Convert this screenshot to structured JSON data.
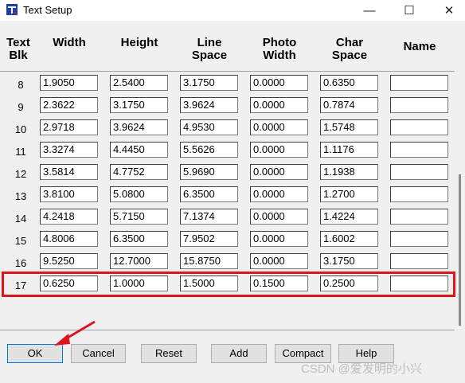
{
  "window": {
    "title": "Text Setup",
    "minimize_glyph": "—",
    "maximize_glyph": "☐",
    "close_glyph": "✕"
  },
  "headers": {
    "text_blk": [
      "Text",
      "Blk"
    ],
    "width": "Width",
    "height": "Height",
    "line_space": [
      "Line",
      "Space"
    ],
    "photo_width": [
      "Photo",
      "Width"
    ],
    "char_space": [
      "Char",
      "Space"
    ],
    "name": "Name"
  },
  "rows": [
    {
      "blk": "8",
      "width": "1.9050",
      "height": "2.5400",
      "line_space": "3.1750",
      "photo_width": "0.0000",
      "char_space": "0.6350",
      "name": ""
    },
    {
      "blk": "9",
      "width": "2.3622",
      "height": "3.1750",
      "line_space": "3.9624",
      "photo_width": "0.0000",
      "char_space": "0.7874",
      "name": ""
    },
    {
      "blk": "10",
      "width": "2.9718",
      "height": "3.9624",
      "line_space": "4.9530",
      "photo_width": "0.0000",
      "char_space": "1.5748",
      "name": ""
    },
    {
      "blk": "11",
      "width": "3.3274",
      "height": "4.4450",
      "line_space": "5.5626",
      "photo_width": "0.0000",
      "char_space": "1.1176",
      "name": ""
    },
    {
      "blk": "12",
      "width": "3.5814",
      "height": "4.7752",
      "line_space": "5.9690",
      "photo_width": "0.0000",
      "char_space": "1.1938",
      "name": ""
    },
    {
      "blk": "13",
      "width": "3.8100",
      "height": "5.0800",
      "line_space": "6.3500",
      "photo_width": "0.0000",
      "char_space": "1.2700",
      "name": ""
    },
    {
      "blk": "14",
      "width": "4.2418",
      "height": "5.7150",
      "line_space": "7.1374",
      "photo_width": "0.0000",
      "char_space": "1.4224",
      "name": ""
    },
    {
      "blk": "15",
      "width": "4.8006",
      "height": "6.3500",
      "line_space": "7.9502",
      "photo_width": "0.0000",
      "char_space": "1.6002",
      "name": ""
    },
    {
      "blk": "16",
      "width": "9.5250",
      "height": "12.7000",
      "line_space": "15.8750",
      "photo_width": "0.0000",
      "char_space": "3.1750",
      "name": ""
    },
    {
      "blk": "17",
      "width": "0.6250",
      "height": "1.0000",
      "line_space": "1.5000",
      "photo_width": "0.1500",
      "char_space": "0.2500",
      "name": ""
    }
  ],
  "buttons": {
    "ok": "OK",
    "cancel": "Cancel",
    "reset": "Reset",
    "add": "Add",
    "compact": "Compact",
    "help": "Help"
  },
  "watermark": "CSDN @爱发明的小兴",
  "colors": {
    "highlight": "#e0151b",
    "arrow": "#e0151b",
    "primary_border": "#0078d7"
  },
  "icons": {
    "app": "text-setup-app-icon",
    "arrow": "red-annotation-arrow"
  }
}
